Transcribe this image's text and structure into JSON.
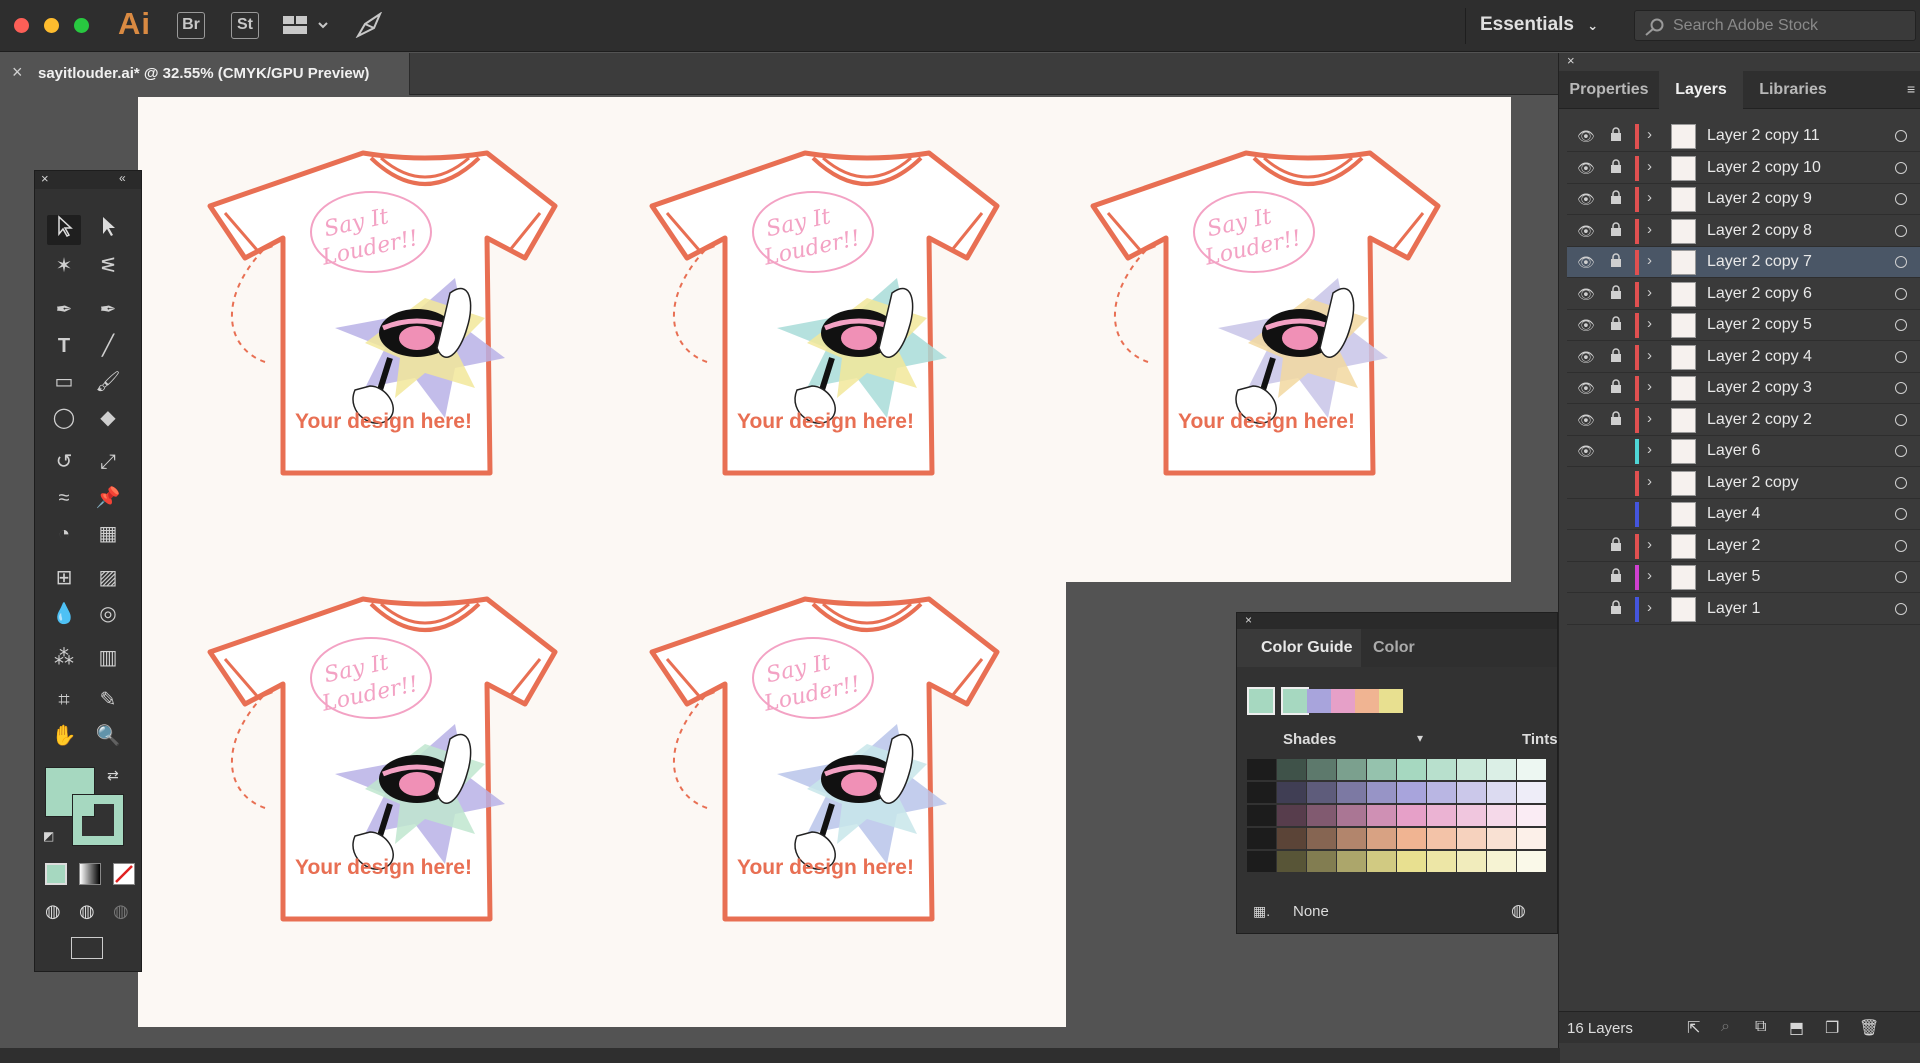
{
  "app": {
    "logo": "Ai",
    "bridge": "Br",
    "stock_btn": "St",
    "workspace": "Essentials",
    "search_placeholder": "Search Adobe Stock"
  },
  "document": {
    "tab_title": "sayitlouder.ai* @ 32.55% (CMYK/GPU Preview)"
  },
  "artboard": {
    "design_text": "Your design here!",
    "shirt_text_line1": "Say It",
    "shirt_text_line2": "Louder!!"
  },
  "panels": {
    "tabs": [
      "Properties",
      "Layers",
      "Libraries"
    ],
    "active_tab": "Layers",
    "layers": [
      {
        "name": "Layer 2 copy 11",
        "color": "#e05050",
        "visible": true,
        "locked": true,
        "selected": false
      },
      {
        "name": "Layer 2 copy 10",
        "color": "#e05050",
        "visible": true,
        "locked": true,
        "selected": false
      },
      {
        "name": "Layer 2 copy 9",
        "color": "#e05050",
        "visible": true,
        "locked": true,
        "selected": false
      },
      {
        "name": "Layer 2 copy 8",
        "color": "#e05050",
        "visible": true,
        "locked": true,
        "selected": false
      },
      {
        "name": "Layer 2 copy 7",
        "color": "#e05050",
        "visible": true,
        "locked": true,
        "selected": true
      },
      {
        "name": "Layer 2 copy 6",
        "color": "#e05050",
        "visible": true,
        "locked": true,
        "selected": false
      },
      {
        "name": "Layer 2 copy 5",
        "color": "#e05050",
        "visible": true,
        "locked": true,
        "selected": false
      },
      {
        "name": "Layer 2 copy 4",
        "color": "#e05050",
        "visible": true,
        "locked": true,
        "selected": false
      },
      {
        "name": "Layer 2 copy 3",
        "color": "#e05050",
        "visible": true,
        "locked": true,
        "selected": false
      },
      {
        "name": "Layer 2 copy 2",
        "color": "#e05050",
        "visible": true,
        "locked": true,
        "selected": false
      },
      {
        "name": "Layer 6",
        "color": "#4fd6d6",
        "visible": true,
        "locked": false,
        "selected": false
      },
      {
        "name": "Layer 2 copy",
        "color": "#e05050",
        "visible": false,
        "locked": false,
        "selected": false
      },
      {
        "name": "Layer 4",
        "color": "#4455dd",
        "visible": false,
        "locked": false,
        "selected": false
      },
      {
        "name": "Layer 2",
        "color": "#e05050",
        "visible": false,
        "locked": true,
        "selected": false
      },
      {
        "name": "Layer 5",
        "color": "#d040d0",
        "visible": false,
        "locked": true,
        "selected": false
      },
      {
        "name": "Layer 1",
        "color": "#4455dd",
        "visible": false,
        "locked": true,
        "selected": false
      }
    ],
    "layer_count": "16 Layers"
  },
  "color_guide": {
    "tabs": [
      "Color Guide",
      "Color"
    ],
    "shades_label": "Shades",
    "tints_label": "Tints",
    "none_label": "None",
    "harmony": [
      "#a6d8c0",
      "#a8a4dc",
      "#e6a0c8",
      "#f0b492",
      "#e8e090"
    ],
    "base_color": "#a6d8c0"
  },
  "tools": {
    "fill_color": "#a6d8c0",
    "stroke_color": "#a6d8c0"
  }
}
